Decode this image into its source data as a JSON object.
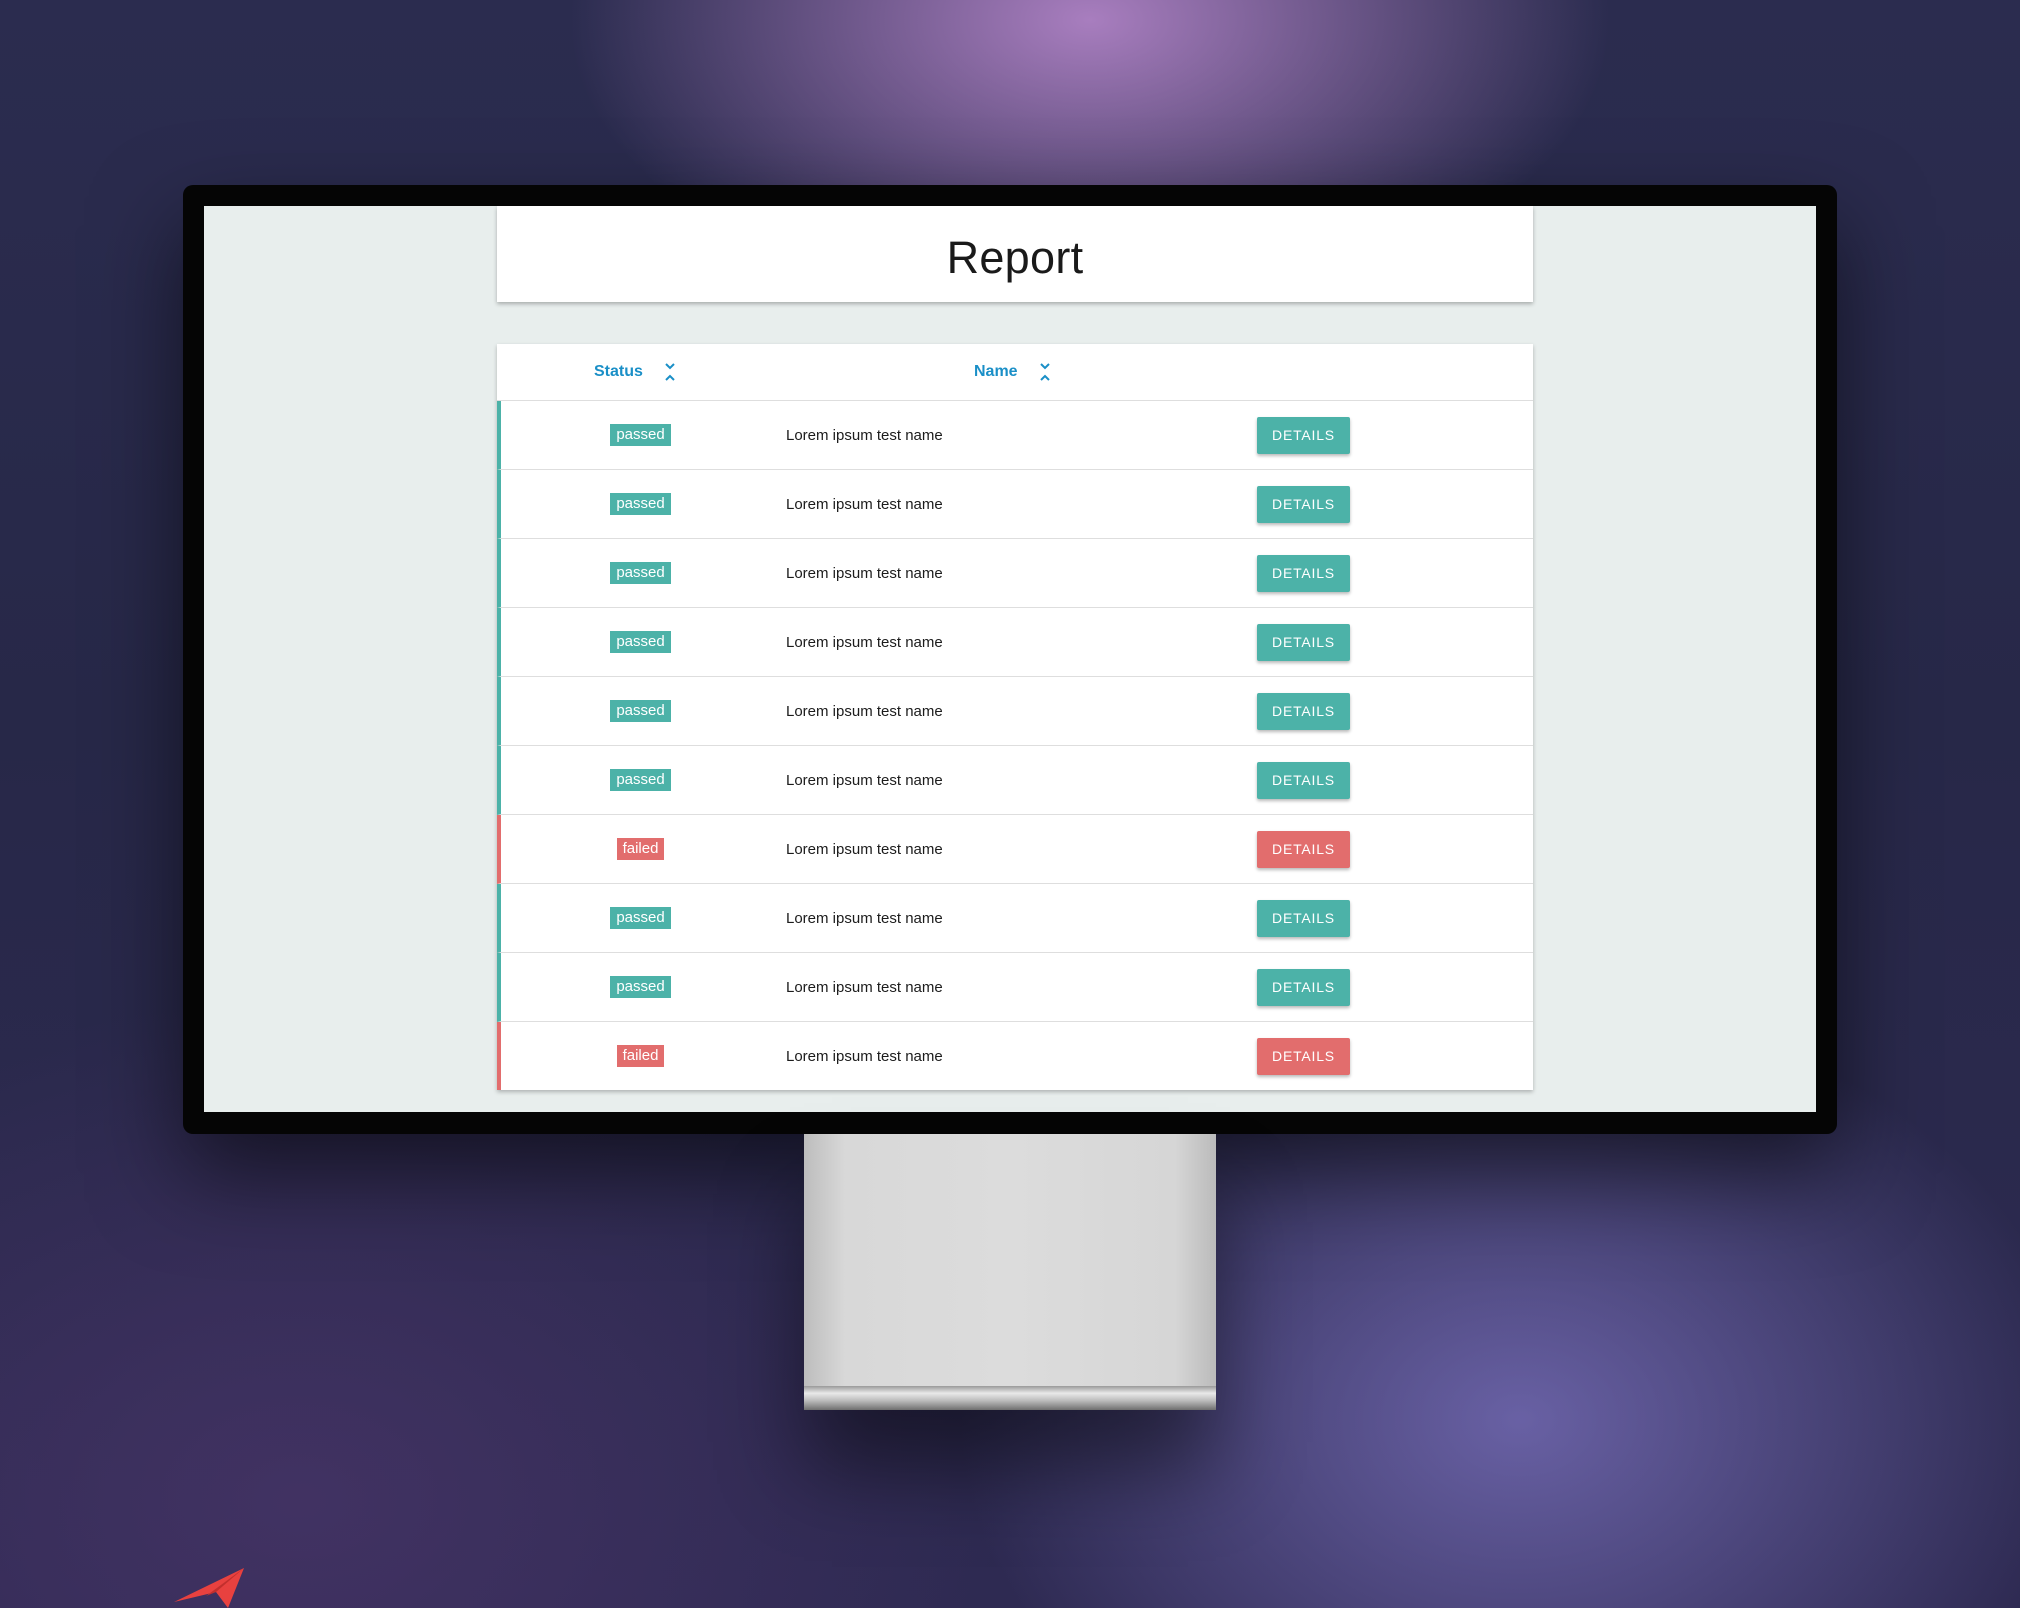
{
  "report": {
    "title": "Report"
  },
  "table": {
    "columns": {
      "status": "Status",
      "name": "Name"
    },
    "rows": [
      {
        "status": "passed",
        "name": "Lorem ipsum test name",
        "action": "DETAILS"
      },
      {
        "status": "passed",
        "name": "Lorem ipsum test name",
        "action": "DETAILS"
      },
      {
        "status": "passed",
        "name": "Lorem ipsum test name",
        "action": "DETAILS"
      },
      {
        "status": "passed",
        "name": "Lorem ipsum test name",
        "action": "DETAILS"
      },
      {
        "status": "passed",
        "name": "Lorem ipsum test name",
        "action": "DETAILS"
      },
      {
        "status": "passed",
        "name": "Lorem ipsum test name",
        "action": "DETAILS"
      },
      {
        "status": "failed",
        "name": "Lorem ipsum test name",
        "action": "DETAILS"
      },
      {
        "status": "passed",
        "name": "Lorem ipsum test name",
        "action": "DETAILS"
      },
      {
        "status": "passed",
        "name": "Lorem ipsum test name",
        "action": "DETAILS"
      },
      {
        "status": "failed",
        "name": "Lorem ipsum test name",
        "action": "DETAILS"
      }
    ]
  },
  "icons": {
    "sort": "sort-icon",
    "brand": "paper-plane-icon"
  },
  "colors": {
    "passed": "#4cb2a8",
    "failed": "#e26d6d",
    "header_accent": "#1a8fc7",
    "screen_background": "#e8eeed",
    "brand_logo": "#e8413f"
  }
}
